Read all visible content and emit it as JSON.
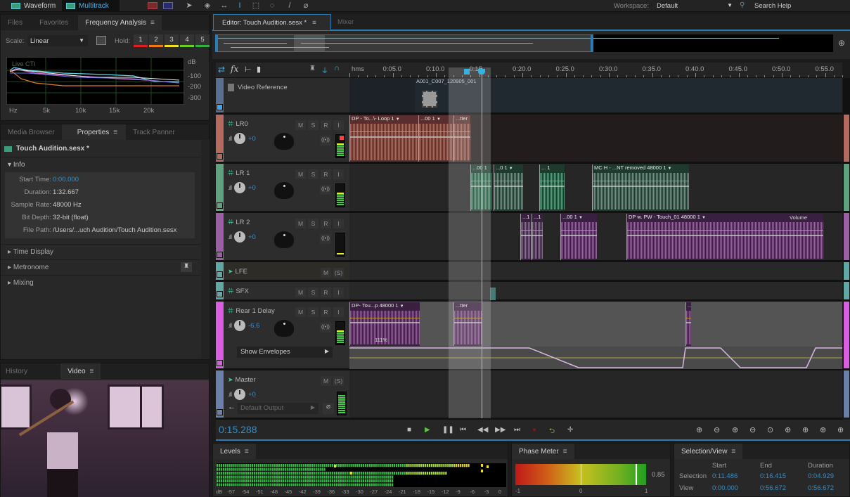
{
  "topbar": {
    "modes": [
      "Waveform",
      "Multitrack"
    ],
    "active_mode": "Multitrack",
    "workspace_label": "Workspace:",
    "workspace_value": "Default",
    "search_label": "Search Help"
  },
  "freq_panel": {
    "tabs": [
      "Files",
      "Favorites",
      "Frequency Analysis"
    ],
    "active_tab": "Frequency Analysis",
    "scale_label": "Scale:",
    "scale_value": "Linear",
    "hold_label": "Hold:",
    "hold_buttons": [
      {
        "label": "1",
        "color": "#e02020"
      },
      {
        "label": "2",
        "color": "#f07a10"
      },
      {
        "label": "3",
        "color": "#f0e020"
      },
      {
        "label": "4",
        "color": "#70d020"
      },
      {
        "label": "5",
        "color": "#30b040"
      }
    ],
    "graph_label": "Live CTI",
    "db_label": "dB",
    "y_ticks": [
      "-100",
      "-200",
      "-300"
    ],
    "x_ticks": [
      "Hz",
      "5k",
      "10k",
      "15k",
      "20k"
    ]
  },
  "props_panel": {
    "tabs": [
      "Media Browser",
      "Properties",
      "Track Panner"
    ],
    "active_tab": "Properties",
    "file_name": "Touch Audition.sesx *",
    "info_header": "Info",
    "info": [
      {
        "label": "Start Time:",
        "value": "0:00.000",
        "highlight": true
      },
      {
        "label": "Duration:",
        "value": "1:32.667"
      },
      {
        "label": "Sample Rate:",
        "value": "48000 Hz"
      },
      {
        "label": "Bit Depth:",
        "value": "32-bit (float)"
      },
      {
        "label": "File Path:",
        "value": "/Users/...uch Audition/Touch Audition.sesx"
      }
    ],
    "sections": [
      "Time Display",
      "Metronome",
      "Mixing"
    ]
  },
  "video_panel": {
    "tabs": [
      "History",
      "Video"
    ],
    "active_tab": "Video"
  },
  "editor": {
    "tabs": [
      "Editor: Touch Audition.sesx *",
      "Mixer"
    ],
    "active_tab": "Editor: Touch Audition.sesx *",
    "ruler": [
      "hms",
      "0:05.0",
      "0:10.0",
      "0:15",
      "0:20.0",
      "0:25.0",
      "0:30.0",
      "0:35.0",
      "0:40.0",
      "0:45.0",
      "0:50.0",
      "0:55.0"
    ],
    "current_time": "0:15.288",
    "video_track": {
      "name": "Video Reference",
      "clip_name": "A001_C007_120905_001"
    },
    "tracks": [
      {
        "name": "LR0",
        "volume": "+0",
        "color": "#b46a5e",
        "buttons": [
          "M",
          "S",
          "R",
          "I"
        ],
        "clips": [
          "DP - To...\\- Loop 1",
          "...00 1",
          "...tter"
        ]
      },
      {
        "name": "LR 1",
        "volume": "+0",
        "color": "#5ea27e",
        "buttons": [
          "M",
          "S",
          "R",
          "I"
        ],
        "clips": [
          "...00 1",
          "...0 1",
          "... 1",
          "MC H - ...NT removed 48000 1"
        ]
      },
      {
        "name": "LR 2",
        "volume": "+0",
        "color": "#9c5ea4",
        "buttons": [
          "M",
          "S",
          "R",
          "I"
        ],
        "clips": [
          "...1",
          "...1",
          "...00 1",
          "DP w. PW - Touch_01 48000 1"
        ],
        "clip_param": "Volume"
      },
      {
        "name": "LFE",
        "color": "#5fa8a4",
        "buttons": [
          "M",
          "(S)"
        ]
      },
      {
        "name": "SFX",
        "color": "#5fa8a4",
        "buttons": [
          "M",
          "S",
          "R",
          "I"
        ]
      },
      {
        "name": "Rear 1 Delay",
        "volume": "-6.6",
        "color": "#d95fe0",
        "buttons": [
          "M",
          "S",
          "R",
          "I"
        ],
        "clips": [
          "DP- Tou...p 48000 1",
          "...tter",
          "... 1"
        ],
        "clip_stretch": "111%",
        "envelope_label": "Show Envelopes"
      },
      {
        "name": "Master",
        "volume": "+0",
        "color": "#6a80a8",
        "buttons": [
          "M",
          "(S)"
        ],
        "output": "Default Output"
      }
    ]
  },
  "levels": {
    "title": "Levels",
    "scale": [
      "dB",
      "-57",
      "-54",
      "-51",
      "-48",
      "-45",
      "-42",
      "-39",
      "-36",
      "-33",
      "-30",
      "-27",
      "-24",
      "-21",
      "-18",
      "-15",
      "-12",
      "-9",
      "-6",
      "-3",
      "0"
    ]
  },
  "phase_meter": {
    "title": "Phase Meter",
    "value": "0.85",
    "scale": [
      "-1",
      "0",
      "1"
    ]
  },
  "selection_view": {
    "title": "Selection/View",
    "columns": [
      "Start",
      "End",
      "Duration"
    ],
    "rows": [
      {
        "label": "Selection",
        "values": [
          "0:11.486",
          "0:16.415",
          "0:04.929"
        ]
      },
      {
        "label": "View",
        "values": [
          "0:00.000",
          "0:56.672",
          "0:56.672"
        ]
      }
    ]
  }
}
